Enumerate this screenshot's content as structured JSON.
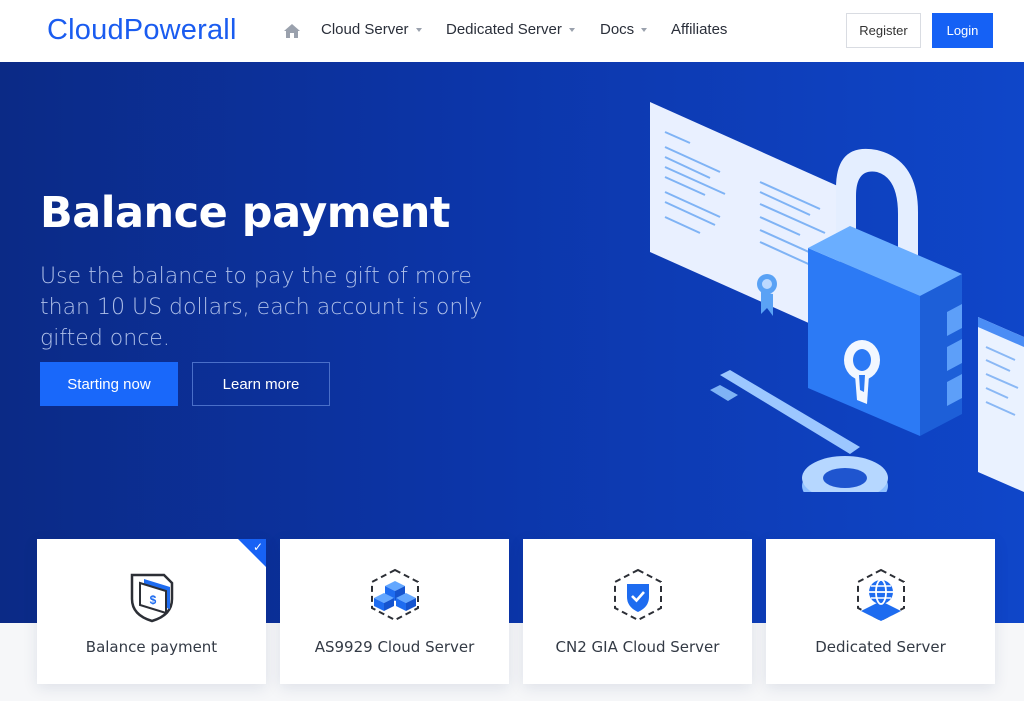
{
  "brand": {
    "name": "CloudPowerall"
  },
  "nav": {
    "home_icon": "home-icon",
    "items": [
      {
        "label": "Cloud Server",
        "has_dropdown": true
      },
      {
        "label": "Dedicated Server",
        "has_dropdown": true
      },
      {
        "label": "Docs",
        "has_dropdown": true
      },
      {
        "label": "Affiliates",
        "has_dropdown": false
      }
    ],
    "register_label": "Register",
    "login_label": "Login"
  },
  "hero": {
    "title": "Balance payment",
    "subtitle": "Use the balance to pay the gift of more than 10 US dollars, each account is only gifted once.",
    "primary_button": "Starting now",
    "secondary_button": "Learn more",
    "illustration": "padlock-and-key-illustration"
  },
  "cards": [
    {
      "label": "Balance payment",
      "icon": "wallet-shield-icon",
      "selected": true
    },
    {
      "label": "AS9929 Cloud Server",
      "icon": "cubes-icon",
      "selected": false
    },
    {
      "label": "CN2 GIA Cloud Server",
      "icon": "shield-check-icon",
      "selected": false
    },
    {
      "label": "Dedicated Server",
      "icon": "globe-server-icon",
      "selected": false
    }
  ],
  "colors": {
    "brand": "#1a5cf0",
    "primary": "#1561f5",
    "hero_dark": "#0b2a86",
    "hero_light": "#0f46c9"
  }
}
